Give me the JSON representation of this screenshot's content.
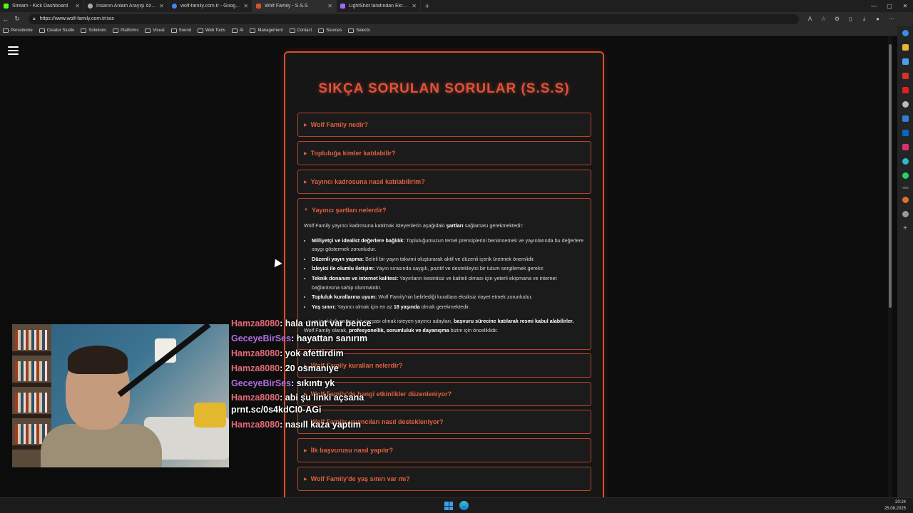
{
  "browser": {
    "tabs": [
      {
        "label": "Stream - Kick Dashboard",
        "color": "#53fc18"
      },
      {
        "label": "İnsanın Anlam Arayışı özeti",
        "color": "#aaaaaa"
      },
      {
        "label": "wolf-family.com.tr - Google'da Ar",
        "color": "#4285f4"
      },
      {
        "label": "Wolf Family - S.S.S",
        "color": "#d8502f"
      },
      {
        "label": "LightShot tarafından Ekran Görü",
        "color": "#9c6bff"
      }
    ],
    "url": "https://www.wolf-family.com.tr/sss",
    "bookmarks": [
      "Persodome",
      "Creator Studio",
      "Solutions",
      "Platforms",
      "Visual",
      "Sound",
      "Web Tools",
      "AI",
      "Management",
      "Contact",
      "Sources",
      "Selects"
    ]
  },
  "faq": {
    "title": "SIKÇA SORULAN SORULAR (S.S.S)",
    "questions": [
      "Wolf Family nedir?",
      "Topluluğa kimler katılabilir?",
      "Yayıncı kadrosuna nasıl katılabilirim?",
      "Yayıncı şartları nelerdir?",
      "Wolf Family kuralları nelerdir?",
      "Wolf Family'de hangi etkinlikler düzenleniyor?",
      "Wolf Family yayıncıları nasıl destekleniyor?",
      "İlk başvurusu nasıl yapılır?",
      "Wolf Family'de yaş sınırı var mı?"
    ],
    "open_answer": {
      "intro_pre": "Wolf Family yayıncı kadrosuna katılmak isteyenlerin aşağıdaki ",
      "intro_bold": "şartları",
      "intro_post": " sağlaması gerekmektedir:",
      "items": [
        {
          "bold": "Milliyetçi ve idealist değerlere bağlılık:",
          "text": " Topluluğumuzun temel prensiplerini benimsemek ve yayınlarında bu değerlere saygı göstermek zorunludur."
        },
        {
          "bold": "Düzenli yayın yapma:",
          "text": " Belirli bir yayın takvimi oluşturarak aktif ve düzenli içerik üretmek önemlidir."
        },
        {
          "bold": "İzleyici ile olumlu iletişim:",
          "text": " Yayın sırasında saygılı, pozitif ve destekleyici bir tutum sergilemek gerekir."
        },
        {
          "bold": "Teknik donanım ve internet kalitesi:",
          "text": " Yayınların kesintisiz ve kaliteli olması için yeterli ekipmana ve internet bağlantısına sahip olunmalıdır."
        },
        {
          "bold": "Topluluk kurallarına uyum:",
          "text": " Wolf Family'nin belirlediği kurallara eksiksiz riayet etmek zorunludur."
        },
        {
          "bold": "Yaş sınırı:",
          "text": " Yayıncı olmak için en az ",
          "bold2": "18 yaşında",
          "text2": " olmak gerekmektedir."
        }
      ],
      "outro_pre": "...n ve topluluğumuzun bir parçası olmak isteyen yayıncı adayları, ",
      "outro_bold1": "başvuru sürecine katılarak resmi kabul alabilirler.",
      "outro_mid": " Wolf Family olarak, ",
      "outro_bold2": "profesyonellik, sorumluluk ve dayanışma",
      "outro_post": " bizim için önceliklidir."
    }
  },
  "chat": [
    {
      "user": "Hamza8080",
      "color": "red",
      "text": ": hala umut var bence"
    },
    {
      "user": "GeceyeBirSes",
      "color": "purple",
      "text": ": hayattan sanırım"
    },
    {
      "user": "Hamza8080",
      "color": "red",
      "text": ": yok afettirdim"
    },
    {
      "user": "Hamza8080",
      "color": "red",
      "text": ": 20 osmaniye"
    },
    {
      "user": "GeceyeBirSes",
      "color": "purple",
      "text": ": sıkıntı yk"
    },
    {
      "user": "Hamza8080",
      "color": "red",
      "text": ": abi şu linki açsana prnt.sc/0s4kdCI0-AGi"
    },
    {
      "user": "Hamza8080",
      "color": "red",
      "text": ": nasıll kaza yaptım"
    }
  ],
  "clock": {
    "time": "20:24",
    "date": "25.08.2025"
  },
  "colors": {
    "accent": "#d8502f",
    "chat_red": "#e26a78",
    "chat_purple": "#b06ee0"
  }
}
